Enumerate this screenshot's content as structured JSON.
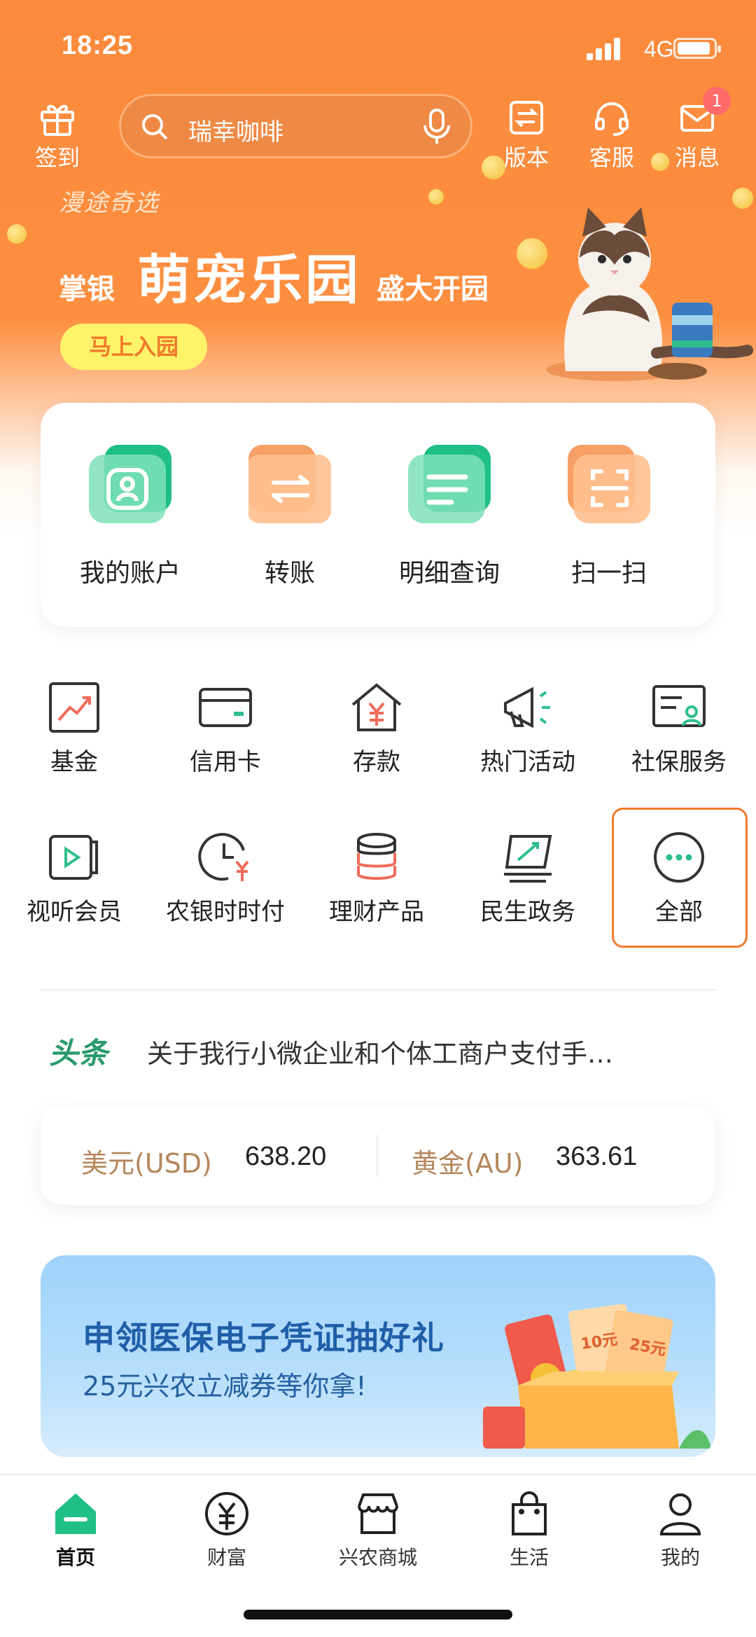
{
  "status_bar": {
    "time": "18:25",
    "network": "4G"
  },
  "top_bar": {
    "checkin_label": "签到",
    "search_placeholder": "瑞幸咖啡",
    "version_label": "版本",
    "service_label": "客服",
    "messages_label": "消息",
    "messages_badge": "1"
  },
  "banner": {
    "brand": "漫途奇选",
    "title_prefix": "掌银",
    "title_main": "萌宠乐园",
    "title_suffix": "盛大开园",
    "cta": "马上入园"
  },
  "quick_actions": [
    {
      "label": "我的账户",
      "icon": "account-icon"
    },
    {
      "label": "转账",
      "icon": "transfer-icon"
    },
    {
      "label": "明细查询",
      "icon": "details-icon"
    },
    {
      "label": "扫一扫",
      "icon": "scan-icon"
    }
  ],
  "services_row1": [
    {
      "label": "基金",
      "icon": "fund-chart-icon"
    },
    {
      "label": "信用卡",
      "icon": "credit-card-icon"
    },
    {
      "label": "存款",
      "icon": "deposit-house-icon"
    },
    {
      "label": "热门活动",
      "icon": "megaphone-icon"
    },
    {
      "label": "社保服务",
      "icon": "social-security-icon"
    }
  ],
  "services_row2": [
    {
      "label": "视听会员",
      "icon": "video-play-icon"
    },
    {
      "label": "农银时时付",
      "icon": "clock-payment-icon"
    },
    {
      "label": "理财产品",
      "icon": "coin-stack-icon"
    },
    {
      "label": "民生政务",
      "icon": "government-icon"
    },
    {
      "label": "全部",
      "icon": "more-dots-icon"
    }
  ],
  "headline": {
    "tag": "头条",
    "text": "关于我行小微企业和个体工商户支付手…"
  },
  "rates": {
    "usd_label": "美元(USD)",
    "usd_value": "638.20",
    "gold_label": "黄金(AU)",
    "gold_value": "363.61"
  },
  "promo": {
    "line1": "申领医保电子凭证抽好礼",
    "line2": "25元兴农立减券等你拿!",
    "coupon_a": "10元",
    "coupon_b": "25元"
  },
  "tab_bar": [
    {
      "label": "首页",
      "icon": "home-icon",
      "active": true
    },
    {
      "label": "财富",
      "icon": "wealth-yen-icon",
      "active": false
    },
    {
      "label": "兴农商城",
      "icon": "mall-store-icon",
      "active": false
    },
    {
      "label": "生活",
      "icon": "shopping-bag-icon",
      "active": false
    },
    {
      "label": "我的",
      "icon": "profile-icon",
      "active": false
    }
  ],
  "colors": {
    "brand_orange": "#fb8a3c",
    "brand_green": "#2fbf8a",
    "highlight_border": "#f07a2a",
    "rate_label": "#b4875c"
  }
}
